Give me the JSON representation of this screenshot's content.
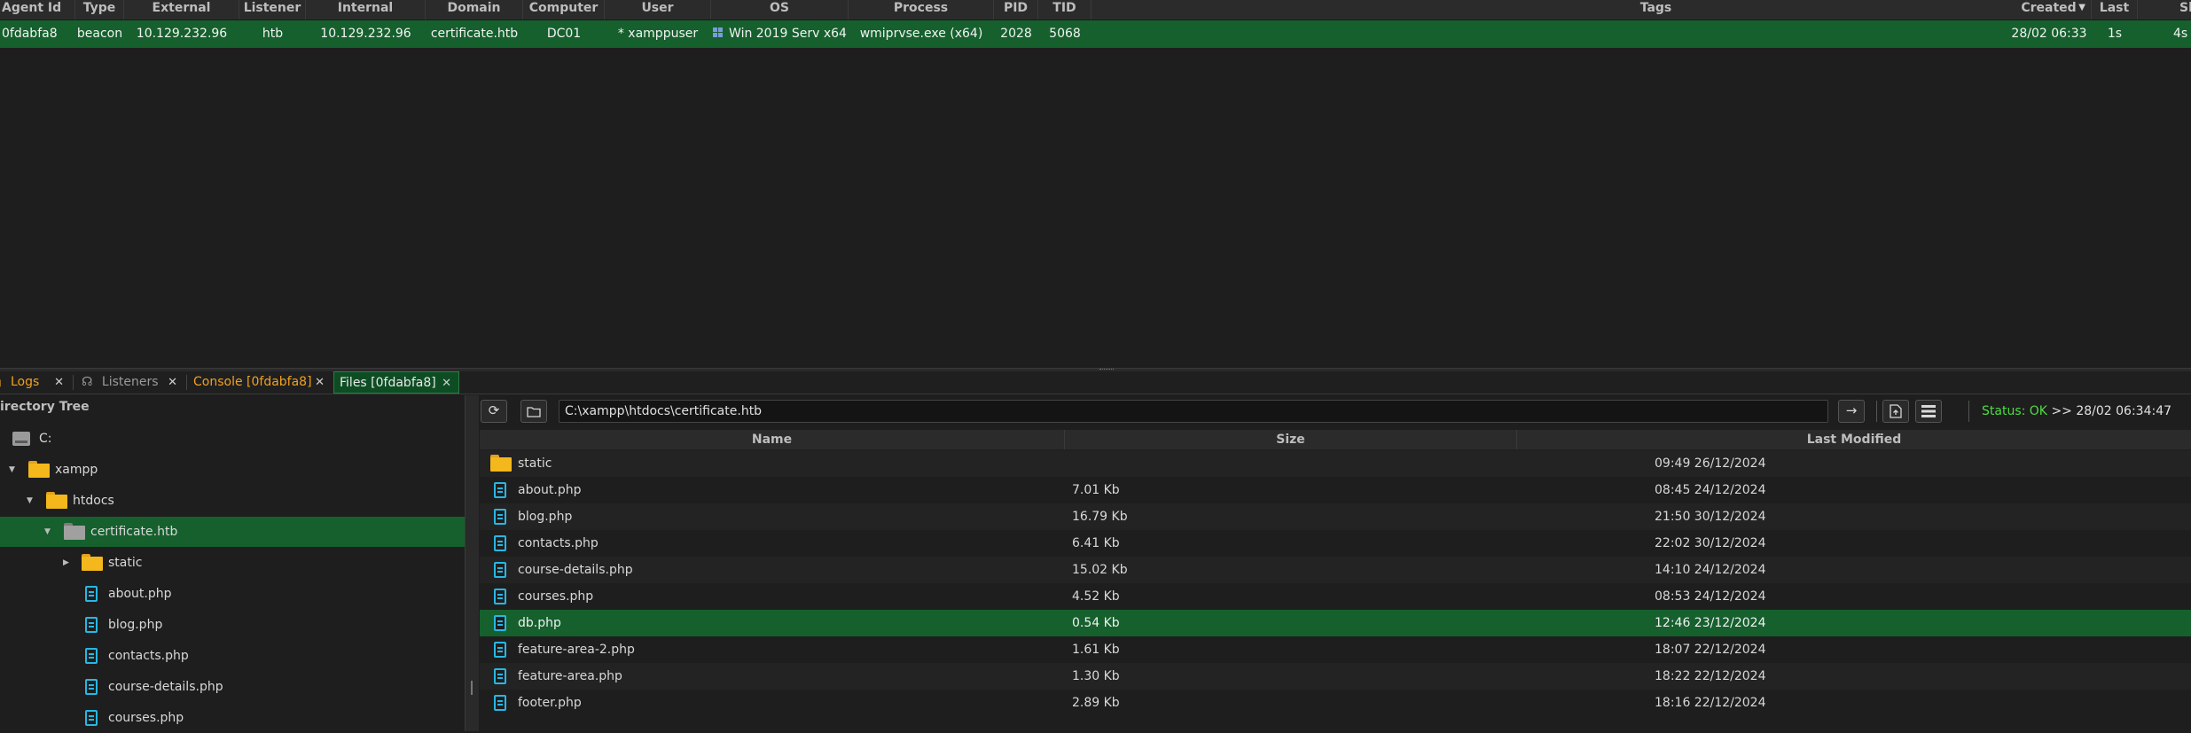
{
  "sessions": {
    "columns": [
      "Agent Id",
      "Type",
      "External",
      "Listener",
      "Internal",
      "Domain",
      "Computer",
      "User",
      "OS",
      "Process",
      "PID",
      "TID",
      "Tags",
      "Created",
      "Last",
      "Sl"
    ],
    "sort_icon": "sort-desc-icon",
    "row": {
      "agent_id": "0fdabfa8",
      "type": "beacon",
      "external": "10.129.232.96",
      "listener": "htb",
      "internal": "10.129.232.96",
      "domain": "certificate.htb",
      "computer": "DC01",
      "user": "* xamppuser",
      "os": "Win 2019 Serv x64",
      "process": "wmiprvse.exe (x64)",
      "pid": "2028",
      "tid": "5068",
      "tags": "",
      "created": "28/02 06:33",
      "last": "1s",
      "sleep": "4s"
    }
  },
  "tabs": [
    {
      "label": "Logs",
      "close": "✕"
    },
    {
      "label": "Listeners",
      "close": "✕"
    },
    {
      "label": "Console [0fdabfa8]",
      "close": "✕"
    },
    {
      "label": "Files [0fdabfa8]",
      "close": "✕"
    }
  ],
  "tree": {
    "title": "irectory Tree",
    "nodes": [
      {
        "label": "C:"
      },
      {
        "label": "xampp"
      },
      {
        "label": "htdocs"
      },
      {
        "label": "certificate.htb"
      },
      {
        "label": "static"
      },
      {
        "label": "about.php"
      },
      {
        "label": "blog.php"
      },
      {
        "label": "contacts.php"
      },
      {
        "label": "course-details.php"
      },
      {
        "label": "courses.php"
      }
    ]
  },
  "toolbar": {
    "path": "C:\\xampp\\htdocs\\certificate.htb",
    "go_glyph": "→",
    "status_label": "Status: OK",
    "status_time": ">> 28/02 06:34:47"
  },
  "file_table": {
    "headers": [
      "Name",
      "Size",
      "Last Modified"
    ],
    "rows": [
      {
        "name": "static",
        "size": "",
        "modified": "09:49 26/12/2024",
        "kind": "folder"
      },
      {
        "name": "about.php",
        "size": "7.01 Kb",
        "modified": "08:45 24/12/2024",
        "kind": "file"
      },
      {
        "name": "blog.php",
        "size": "16.79 Kb",
        "modified": "21:50 30/12/2024",
        "kind": "file"
      },
      {
        "name": "contacts.php",
        "size": "6.41 Kb",
        "modified": "22:02 30/12/2024",
        "kind": "file"
      },
      {
        "name": "course-details.php",
        "size": "15.02 Kb",
        "modified": "14:10 24/12/2024",
        "kind": "file"
      },
      {
        "name": "courses.php",
        "size": "4.52 Kb",
        "modified": "08:53 24/12/2024",
        "kind": "file"
      },
      {
        "name": "db.php",
        "size": "0.54 Kb",
        "modified": "12:46 23/12/2024",
        "kind": "file",
        "selected": true
      },
      {
        "name": "feature-area-2.php",
        "size": "1.61 Kb",
        "modified": "18:07 22/12/2024",
        "kind": "file"
      },
      {
        "name": "feature-area.php",
        "size": "1.30 Kb",
        "modified": "18:22 22/12/2024",
        "kind": "file"
      },
      {
        "name": "footer.php",
        "size": "2.89 Kb",
        "modified": "18:16 22/12/2024",
        "kind": "file"
      }
    ]
  },
  "colors": {
    "selection": "#15602d",
    "accent_orange": "#f0a020",
    "status_ok": "#4fdc45",
    "file_icon": "#27b7e4",
    "folder_icon": "#f4b81c"
  }
}
